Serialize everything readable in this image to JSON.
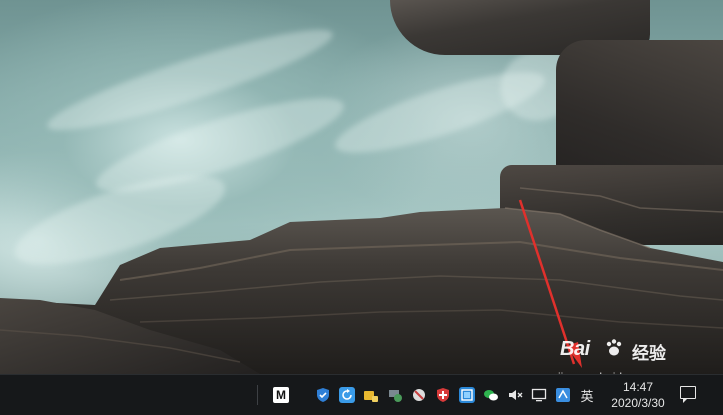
{
  "taskbar": {
    "tray_icons": [
      {
        "name": "m-app-icon",
        "glyph": "M",
        "bg": "#ffffff",
        "fg": "#111111"
      },
      {
        "name": "shield-icon",
        "glyph": "",
        "bg": "#2f7fd6",
        "fg": "#ffffff"
      },
      {
        "name": "refresh-icon",
        "glyph": "",
        "bg": "#3a9be8",
        "fg": "#ffffff"
      },
      {
        "name": "folder-lock-icon",
        "glyph": "",
        "bg": "#e8b830",
        "fg": "#ffffff"
      },
      {
        "name": "network-icon",
        "glyph": "",
        "bg": "#4a9a5a",
        "fg": "#ffffff"
      },
      {
        "name": "security-guard-icon",
        "glyph": "",
        "bg": "#c84040",
        "fg": "#ffffff"
      },
      {
        "name": "red-shield-icon",
        "glyph": "",
        "bg": "#d83a3a",
        "fg": "#ffffff"
      },
      {
        "name": "screenshot-tool-icon",
        "glyph": "",
        "bg": "#2a88d8",
        "fg": "#ffffff"
      },
      {
        "name": "wechat-icon",
        "glyph": "",
        "bg": "#2eb34f",
        "fg": "#ffffff"
      },
      {
        "name": "volume-muted-icon",
        "glyph": "🔇",
        "bg": "transparent",
        "fg": "#e6e6e6"
      },
      {
        "name": "display-icon",
        "glyph": "",
        "bg": "transparent",
        "fg": "#e6e6e6"
      },
      {
        "name": "input-method-icon",
        "glyph": "",
        "bg": "#3a8ee0",
        "fg": "#ffffff"
      }
    ],
    "ime_label": "英",
    "clock_time": "14:47",
    "clock_date": "2020/3/30"
  },
  "watermark": {
    "logo_text": "Bai",
    "brand_text": "经验",
    "url_text": "jingyan.baidu.com"
  },
  "colors": {
    "arrow": "#e0302c",
    "taskbar_bg": "#16181a"
  }
}
